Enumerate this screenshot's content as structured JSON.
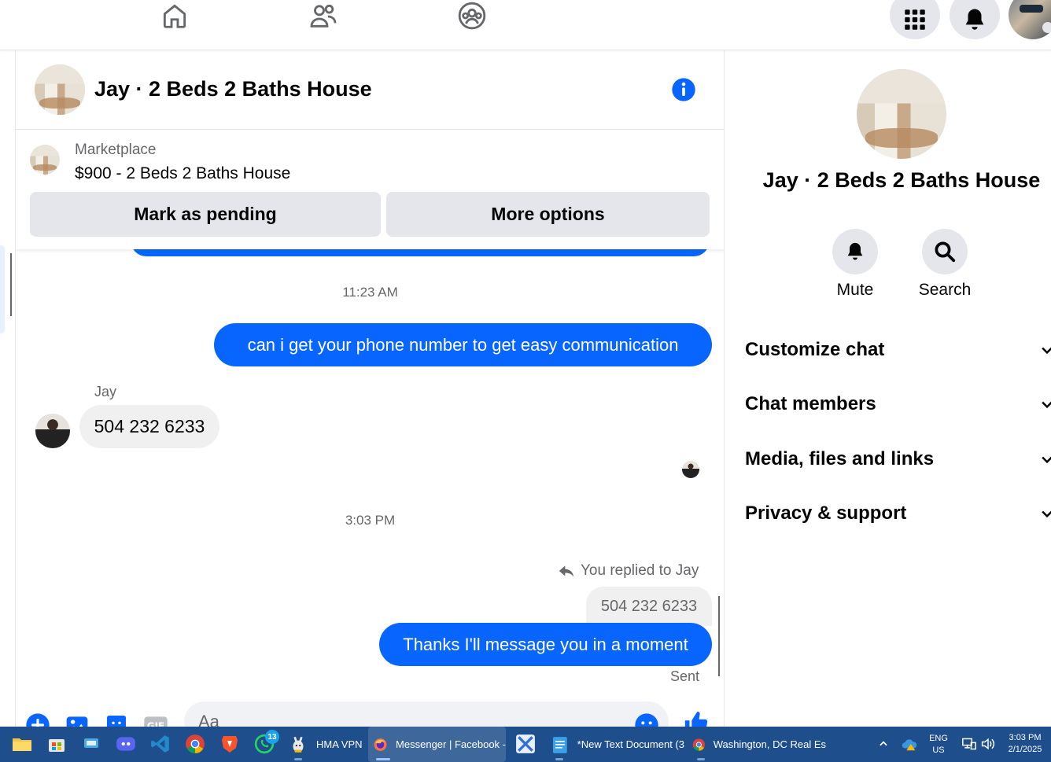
{
  "header": {
    "title": "Jay · 2 Beds 2 Baths House"
  },
  "marketplace": {
    "label": "Marketplace",
    "listing": "$900 - 2 Beds 2 Baths House",
    "pending_button": "Mark as pending",
    "more_button": "More options"
  },
  "messages": {
    "time1": "11:23 AM",
    "out1": "can i get your phone number to get easy communication",
    "sender": "Jay",
    "in1": "504 232 6233",
    "time2": "3:03 PM",
    "replied_to": "You replied to Jay",
    "quoted": "504 232 6233",
    "out2": "Thanks I'll message you in a moment",
    "status": "Sent"
  },
  "composer": {
    "placeholder": "Aa"
  },
  "right_panel": {
    "title": "Jay · 2 Beds 2 Baths House",
    "mute_label": "Mute",
    "search_label": "Search",
    "sections": [
      "Customize chat",
      "Chat members",
      "Media, files and links",
      "Privacy & support"
    ]
  },
  "taskbar": {
    "whatsapp_badge": "13",
    "hma_label": "HMA VPN",
    "firefox_label": "Messenger | Facebook -",
    "notepad_label": "*New Text Document (3",
    "chrome_label": "Washington, DC Real Es",
    "lang_top": "ENG",
    "lang_bottom": "US",
    "time": "3:03 PM",
    "date": "2/1/2025"
  },
  "colors": {
    "accent": "#0866ff",
    "taskbar": "#1f4e8c",
    "muted_text": "#65676b",
    "button_gray": "#e4e6eb"
  }
}
